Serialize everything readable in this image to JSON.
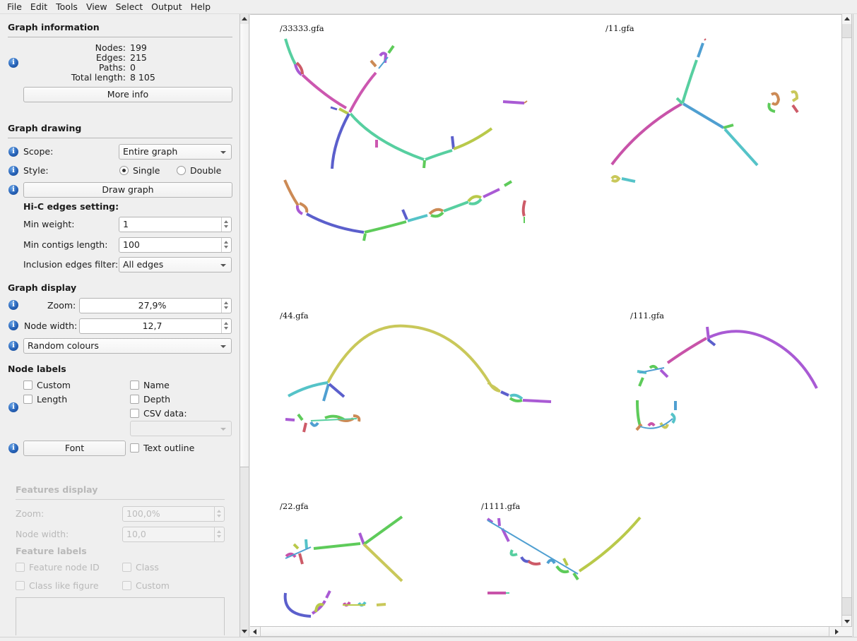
{
  "menu": [
    "File",
    "Edit",
    "Tools",
    "View",
    "Select",
    "Output",
    "Help"
  ],
  "graph_information": {
    "title": "Graph information",
    "stats": [
      {
        "label": "Nodes:",
        "value": "199"
      },
      {
        "label": "Edges:",
        "value": "215"
      },
      {
        "label": "Paths:",
        "value": "0"
      },
      {
        "label": "Total length:",
        "value": "8 105"
      }
    ],
    "more_info_label": "More info"
  },
  "graph_drawing": {
    "title": "Graph drawing",
    "scope_label": "Scope:",
    "scope_value": "Entire graph",
    "style_label": "Style:",
    "style_options": [
      {
        "label": "Single",
        "selected": true
      },
      {
        "label": "Double",
        "selected": false
      }
    ],
    "draw_graph_label": "Draw graph",
    "hic_title": "Hi-C edges setting:",
    "min_weight_label": "Min weight:",
    "min_weight_value": "1",
    "min_contigs_label": "Min contigs length:",
    "min_contigs_value": "100",
    "inclusion_filter_label": "Inclusion edges filter:",
    "inclusion_filter_value": "All edges"
  },
  "graph_display": {
    "title": "Graph display",
    "zoom_label": "Zoom:",
    "zoom_value": "27,9%",
    "node_width_label": "Node width:",
    "node_width_value": "12,7",
    "colour_scheme": "Random colours"
  },
  "node_labels": {
    "title": "Node labels",
    "checkboxes": [
      {
        "label": "Custom",
        "checked": false
      },
      {
        "label": "Name",
        "checked": false
      },
      {
        "label": "Length",
        "checked": false
      },
      {
        "label": "Depth",
        "checked": false
      },
      {
        "label": "CSV data:",
        "checked": false
      }
    ],
    "csv_value": "",
    "font_label": "Font",
    "text_outline_label": "Text outline"
  },
  "features_display": {
    "title": "Features display",
    "zoom_label": "Zoom:",
    "zoom_value": "100,0%",
    "node_width_label": "Node width:",
    "node_width_value": "10,0",
    "feature_labels_title": "Feature labels",
    "checkboxes": [
      {
        "label": "Feature node ID"
      },
      {
        "label": "Class"
      },
      {
        "label": "Class like figure"
      },
      {
        "label": "Custom"
      }
    ]
  },
  "graphs": [
    {
      "name": "/33333.gfa"
    },
    {
      "name": "/11.gfa"
    },
    {
      "name": "/44.gfa"
    },
    {
      "name": "/111.gfa"
    },
    {
      "name": "/22.gfa"
    },
    {
      "name": "/1111.gfa"
    }
  ],
  "colors": {
    "teal": "#57cfa0",
    "pink": "#cc57b0",
    "violet": "#a95ad4",
    "blue": "#5b5fcc",
    "lime": "#b9c94a",
    "green": "#5ecb5a",
    "cyan": "#55c3c8",
    "red": "#cd5b68",
    "orange": "#cc8a55",
    "sky": "#4f9fd1",
    "olive": "#c9c85a",
    "magenta": "#c853a9"
  }
}
